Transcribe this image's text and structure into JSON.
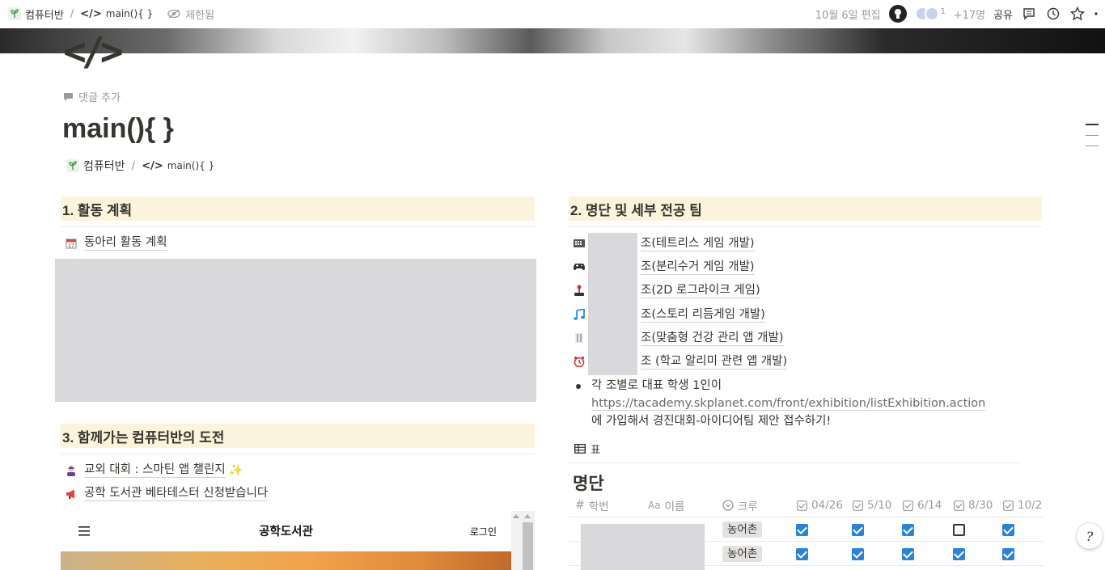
{
  "topbar": {
    "workspace": "컴퓨터반",
    "page": "main(){ }",
    "access": "제한됨",
    "edited": "10월 6일 편집",
    "extra_members": "+17명",
    "avatar_count": "1",
    "share": "공유"
  },
  "page": {
    "add_comment": "댓글 추가",
    "title": "main(){ }",
    "breadcrumb_workspace": "컴퓨터반",
    "breadcrumb_page": "main(){ }"
  },
  "section1": {
    "heading": "1. 활동 계획",
    "link": "동아리 활동 계획",
    "link_icon": "calendar-icon"
  },
  "section3": {
    "heading": "3. 함께가는 컴퓨터반의 도전",
    "items": [
      {
        "label": "교외 대회 : 스마틴 앱 챌린지",
        "icon": "person-icon",
        "suffix": "✨"
      },
      {
        "label": "공학 도서관 베타테스터 신청받습니다",
        "icon": "megaphone-icon"
      }
    ],
    "embed": {
      "title": "공학도서관",
      "login": "로그인"
    }
  },
  "section2": {
    "heading": "2. 명단 및 세부 전공 팀",
    "teams": [
      {
        "suffix": "조(테트리스 게임 개발)",
        "icon": "tetris-icon"
      },
      {
        "suffix": "조(분리수거 게임 개발)",
        "icon": "gamepad-icon"
      },
      {
        "suffix": "조(2D 로그라이크 게임)",
        "icon": "joystick-icon"
      },
      {
        "suffix": "조(스토리 리듬게임 개발)",
        "icon": "music-note-icon"
      },
      {
        "suffix": "조(맞춤형 건강 관리 앱 개발)",
        "icon": "fork-knife-icon"
      },
      {
        "suffix": "조 (학교 알리미 관련 앱 개발)",
        "icon": "alarm-clock-icon"
      }
    ],
    "bullet": {
      "line1": "각 조별로 대표 학생 1인이",
      "url": "https://tacademy.skplanet.com/front/exhibition/listExhibition.action",
      "line3": "에 가입해서 경진대회-아이디어팀 제안 접수하기!"
    },
    "view_label": "표",
    "db_title": "명단",
    "columns": [
      "학번",
      "이름",
      "크루",
      "04/26",
      "5/10",
      "6/14",
      "8/30",
      "10/2"
    ],
    "column_icons": [
      "hash-icon",
      "text-icon",
      "select-icon"
    ],
    "rows": [
      {
        "crew": "농어촌",
        "checks": [
          true,
          true,
          true,
          false,
          true
        ]
      },
      {
        "crew": "농어촌",
        "checks": [
          true,
          true,
          true,
          true,
          true
        ]
      }
    ]
  },
  "colors": {
    "heading_bg": "#fbf3db",
    "checkbox": "#2783de",
    "redaction": "#d9d9dc",
    "tag_bg": "#e3e2e0"
  }
}
